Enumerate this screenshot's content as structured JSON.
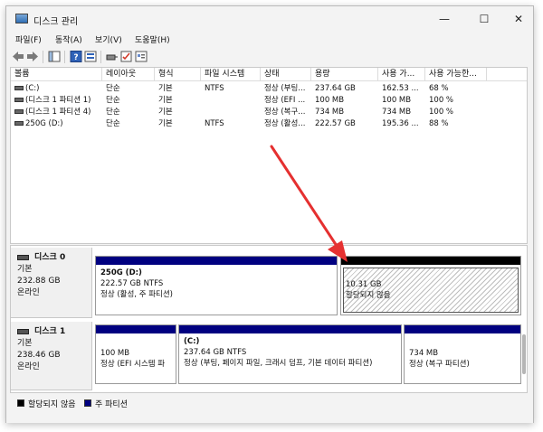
{
  "window": {
    "title": "디스크 관리",
    "controls": [
      "—",
      "☐",
      "✕"
    ]
  },
  "menu": [
    "파일(F)",
    "동작(A)",
    "보기(V)",
    "도움말(H)"
  ],
  "colors": {
    "unallocated": "#000000",
    "primary": "#000080",
    "arrow": "#e53030"
  },
  "table": {
    "columns": [
      "볼륨",
      "레이아웃",
      "형식",
      "파일 시스템",
      "상태",
      "용량",
      "사용 가...",
      "사용 가능한..."
    ],
    "rows": [
      [
        "(C:)",
        "단순",
        "기본",
        "NTFS",
        "정상 (부팅...",
        "237.64 GB",
        "162.53 ...",
        "68 %"
      ],
      [
        "(디스크 1 파티션 1)",
        "단순",
        "기본",
        "",
        "정상 (EFI ...",
        "100 MB",
        "100 MB",
        "100 %"
      ],
      [
        "(디스크 1 파티션 4)",
        "단순",
        "기본",
        "",
        "정상 (복구...",
        "734 MB",
        "734 MB",
        "100 %"
      ],
      [
        "250G (D:)",
        "단순",
        "기본",
        "NTFS",
        "정상 (활성...",
        "222.57 GB",
        "195.36 ...",
        "88 %"
      ]
    ]
  },
  "disks": [
    {
      "name": "디스크 0",
      "type": "기본",
      "size": "232.88 GB",
      "status": "온라인",
      "partitions": [
        {
          "title": "250G  (D:)",
          "line1": "222.57 GB NTFS",
          "line2": "정상 (활성, 주 파티션)",
          "kind": "primary"
        },
        {
          "title": "",
          "line1": "10.31 GB",
          "line2": "할당되지 않음",
          "kind": "unallocated"
        }
      ]
    },
    {
      "name": "디스크 1",
      "type": "기본",
      "size": "238.46 GB",
      "status": "온라인",
      "partitions": [
        {
          "title": "",
          "line1": "100 MB",
          "line2": "정상 (EFI 시스템 파",
          "kind": "primary"
        },
        {
          "title": "(C:)",
          "line1": "237.64 GB NTFS",
          "line2": "정상 (부팅, 페이지 파일, 크래시 덤프, 기본 데이터 파티션)",
          "kind": "primary"
        },
        {
          "title": "",
          "line1": "734 MB",
          "line2": "정상 (복구 파티션)",
          "kind": "primary"
        }
      ]
    }
  ],
  "legend": [
    {
      "label": "할당되지 않음",
      "color": "#000000"
    },
    {
      "label": "주 파티션",
      "color": "#000080"
    }
  ]
}
